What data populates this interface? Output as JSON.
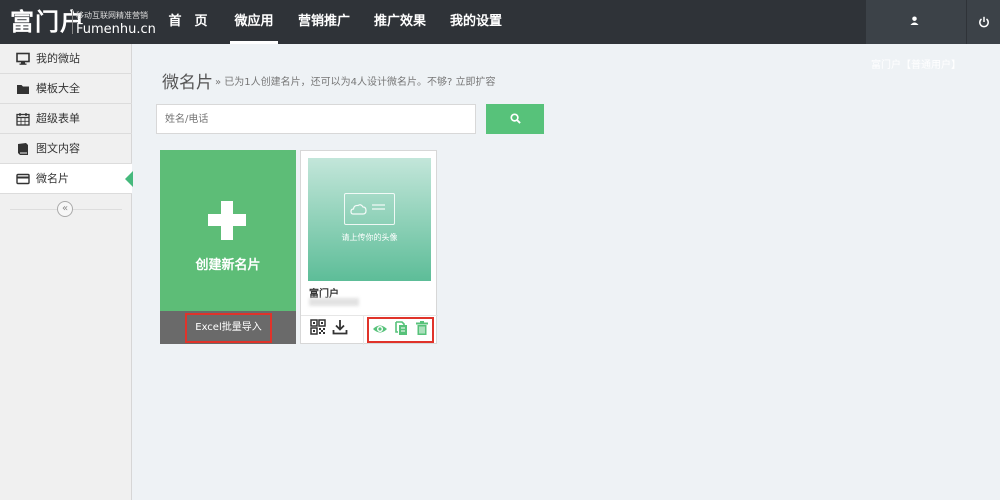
{
  "header": {
    "logo_main": "富门户",
    "logo_sub": "移动互联网精准营销",
    "logo_domain": "Fumenhu.cn",
    "nav": [
      {
        "label": "首　页",
        "active": false
      },
      {
        "label": "微应用",
        "active": true
      },
      {
        "label": "营销推广",
        "active": false
      },
      {
        "label": "推广效果",
        "active": false
      },
      {
        "label": "我的设置",
        "active": false
      }
    ],
    "user_label": "富门户【普通用户】"
  },
  "sidebar": {
    "items": [
      {
        "label": "我的微站",
        "icon": "monitor-icon"
      },
      {
        "label": "模板大全",
        "icon": "folder-icon"
      },
      {
        "label": "超级表单",
        "icon": "calendar-icon"
      },
      {
        "label": "图文内容",
        "icon": "book-icon"
      },
      {
        "label": "微名片",
        "icon": "card-icon",
        "active": true
      }
    ]
  },
  "main": {
    "title": "微名片",
    "hint": "» 已为1人创建名片，还可以为4人设计微名片。不够? 立即扩容",
    "search_placeholder": "姓名/电话",
    "create_label": "创建新名片",
    "excel_label": "Excel批量导入",
    "card": {
      "image_text": "请上传你的头像",
      "name": "富门户"
    }
  },
  "colors": {
    "topbar": "#2f3338",
    "accent": "#57c27a",
    "highlight": "#e0332a"
  }
}
